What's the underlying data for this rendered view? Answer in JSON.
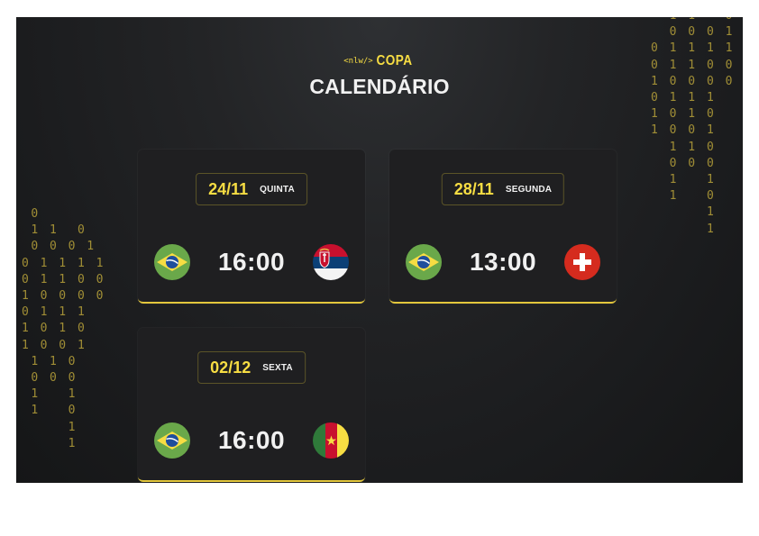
{
  "header": {
    "logo_prefix": "<nlw/>",
    "logo_name": "COPA",
    "title": "CALENDÁRIO"
  },
  "decor": {
    "binary_left": " 0\n 1 1  0\n 0 0 0 1\n0 1 1 1 1\n0 1 1 0 0\n1 0 0 0 0\n0 1 1 1\n1 0 1 0\n1 0 0 1\n 1 1 0\n 0 0 0\n 1   1\n 1   0\n     1\n     1",
    "binary_right": "  1 1   0\n  0 0 0 1\n0 1 1 1 1\n0 1 1 0 0\n1 0 0 0 0\n0 1 1 1\n1 0 1 0\n1 0 0 1\n  1 1 0\n  0 0 0\n  1   1\n  1   0\n      1\n      1"
  },
  "matches": [
    {
      "date": "24/11",
      "weekday": "QUINTA",
      "time": "16:00",
      "home_flag": "brazil-flag-icon",
      "away_flag": "serbia-flag-icon"
    },
    {
      "date": "28/11",
      "weekday": "SEGUNDA",
      "time": "13:00",
      "home_flag": "brazil-flag-icon",
      "away_flag": "switzerland-flag-icon"
    },
    {
      "date": "02/12",
      "weekday": "SEXTA",
      "time": "16:00",
      "home_flag": "brazil-flag-icon",
      "away_flag": "cameroon-flag-icon"
    }
  ],
  "colors": {
    "accent": "#f7dd43",
    "background": "#1b1c1e",
    "card": "#1f1f21",
    "text": "#f1f1f1"
  }
}
